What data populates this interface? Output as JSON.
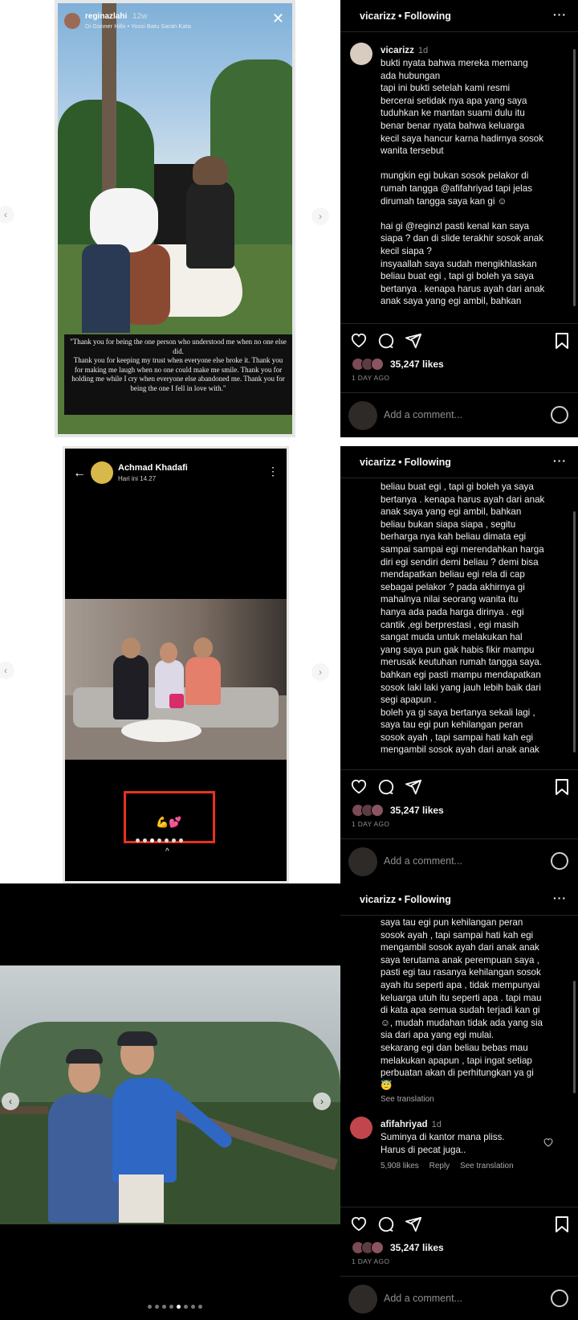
{
  "header": {
    "username": "vicarizz",
    "separator": "•",
    "follow_state": "Following",
    "more": "···"
  },
  "caption_user": "vicarizz",
  "caption_time": "1d",
  "caption_p1": "bukti nyata bahwa mereka memang\nada hubungan\ntapi ini bukti setelah kami resmi\nbercerai setidak nya apa yang saya\ntuduhkan ke mantan suami dulu itu\nbenar benar nyata bahwa keluarga\nkecil saya hancur karna hadirnya sosok\nwanita tersebut\n\nmungkin egi bukan sosok pelakor di\nrumah tangga @afifahriyad tapi jelas\ndirumah tangga saya kan gi ☺\n\nhai gi @reginzl pasti kenal kan saya\nsiapa ? dan di slide terakhir sosok anak\nkecil siapa ?\ninsyaallah saya sudah mengikhlaskan\nbeliau buat egi , tapi gi boleh ya saya\nbertanya . kenapa harus ayah dari anak\nanak saya yang egi ambil, bahkan",
  "caption_p2": "beliau buat egi , tapi gi boleh ya saya\nbertanya . kenapa harus ayah dari anak\nanak saya yang egi ambil, bahkan\nbeliau bukan siapa siapa , segitu\nberharga nya kah beliau dimata egi\nsampai sampai egi merendahkan harga\ndiri egi sendiri demi beliau ? demi bisa\nmendapatkan beliau egi rela di cap\nsebagai pelakor ? pada akhirnya gi\nmahalnya nilai seorang wanita itu\nhanya ada pada harga dirinya . egi\ncantik ,egi berprestasi , egi masih\nsangat muda untuk melakukan hal\nyang saya pun gak habis fikir mampu\nmerusak keutuhan rumah tangga saya.\nbahkan egi pasti mampu mendapatkan\nsosok laki laki yang jauh lebih baik dari\nsegi apapun .\nboleh ya gi saya bertanya sekali lagi ,\nsaya tau egi pun kehilangan peran\nsosok ayah , tapi sampai hati kah egi\nmengambil sosok ayah dari anak anak",
  "caption_p3": "saya tau egi pun kehilangan peran\nsosok ayah , tapi sampai hati kah egi\nmengambil sosok ayah dari anak anak\nsaya terutama anak perempuan saya ,\npasti egi tau rasanya kehilangan sosok\nayah itu seperti apa , tidak mempunyai\nkeluarga utuh itu seperti apa . tapi mau\ndi kata apa semua sudah terjadi kan gi\n☺, mudah mudahan tidak ada yang sia\nsia dari apa yang egi mulai.\nsekarang egi dan beliau bebas mau\nmelakukan apapun , tapi ingat setiap\nperbuatan akan di perhitungkan ya gi\n😇",
  "see_translation": "See translation",
  "reply": {
    "user": "afifahriyad",
    "time": "1d",
    "text": "Suminya di kantor mana pliss.\nHarus di pecat juga..",
    "likes": "5,908 likes",
    "reply_label": "Reply",
    "translate": "See translation"
  },
  "likes": "35,247 likes",
  "ago": "1 DAY AGO",
  "comment_placeholder": "Add a comment...",
  "story": {
    "user": "reginazlahi",
    "time": "12w",
    "subtitle": "Di Gonner Hills • Yossi Batu Sarah Kata",
    "quote": "\"Thank you for being the one person who understood me when no one else did.\nThank you for keeping my trust when everyone else broke it. Thank you for making me laugh when no one could make me smile. Thank you for holding me while I cry when everyone else abandoned me. Thank you for being the one I fell in love with.\""
  },
  "chat": {
    "name": "Achmad Khadafi",
    "time": "Hari ini 14.27",
    "reaction": "💪💕"
  },
  "colors": {
    "accent": "#3897f0",
    "highlight_box": "#e8321e"
  }
}
